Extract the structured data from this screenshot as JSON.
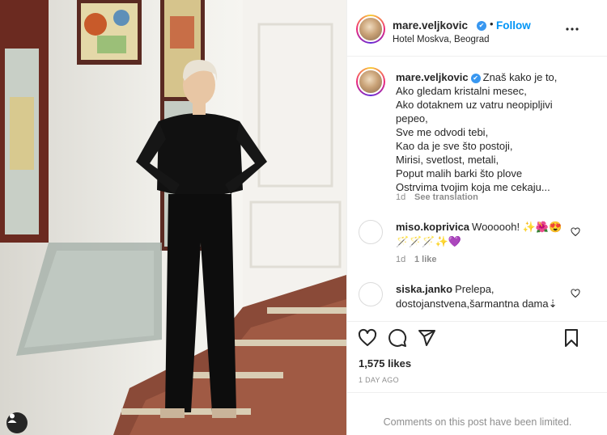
{
  "post": {
    "username": "mare.veljkovic",
    "follow_label": "Follow",
    "dot": "•",
    "location": "Hotel Moskva, Beograd",
    "caption_lines": [
      "Znaš kako je to,",
      "Ako gledam kristalni mesec,",
      "Ako dotaknem uz vatru neopipljivi",
      "pepeo,",
      "Sve me odvodi tebi,",
      "Kao da je sve što postoji,",
      "Mirisi, svetlost, metali,",
      "Poput malih barki što plove",
      "Ostrvima tvojim koja me cekaju..."
    ],
    "caption_age": "1d",
    "see_translation": "See translation",
    "likes": "1,575 likes",
    "ago": "1 DAY AGO",
    "comments_limited": "Comments on this post have been limited."
  },
  "comments": [
    {
      "username": "miso.koprivica",
      "text": "Woooooh! ✨🌺😍",
      "text2": "🪄🪄🪄✨💜",
      "age": "1d",
      "likes": "1 like"
    },
    {
      "username": "siska.janko",
      "text": "Prelepa,",
      "text2": "dostojanstvena,šarmantna dama⇣"
    }
  ],
  "icons": {
    "like": "heart-icon",
    "comment": "comment-icon",
    "share": "share-icon",
    "save": "bookmark-icon",
    "more": "more-horizontal-icon"
  },
  "colors": {
    "follow": "#0095f6",
    "verified": "#3897f0",
    "muted": "#8e8e8e"
  }
}
